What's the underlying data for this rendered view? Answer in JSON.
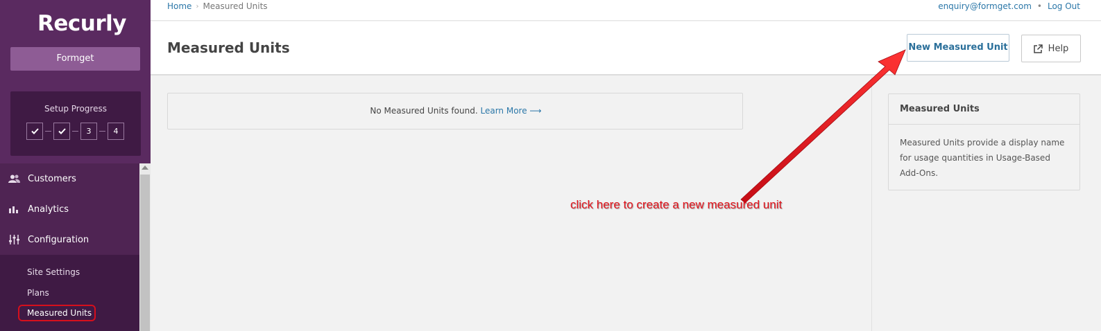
{
  "brand": {
    "logo": "Recurly",
    "site_name": "Formget"
  },
  "setup": {
    "title": "Setup Progress",
    "steps": [
      {
        "label": "",
        "done": true
      },
      {
        "label": "",
        "done": true
      },
      {
        "label": "3",
        "done": false
      },
      {
        "label": "4",
        "done": false
      }
    ]
  },
  "nav": {
    "items": [
      {
        "label": "Customers",
        "icon": "users-icon"
      },
      {
        "label": "Analytics",
        "icon": "bar-chart-icon"
      },
      {
        "label": "Configuration",
        "icon": "sliders-icon"
      }
    ],
    "sub_items": [
      {
        "label": "Site Settings"
      },
      {
        "label": "Plans"
      },
      {
        "label": "Measured Units",
        "active": true
      }
    ]
  },
  "breadcrumb": {
    "home": "Home",
    "current": "Measured Units"
  },
  "user": {
    "email": "enquiry@formget.com",
    "logout": "Log Out"
  },
  "page": {
    "title": "Measured Units",
    "new_button": "New Measured Unit",
    "help_button": "Help",
    "empty_text": "No Measured Units found.",
    "empty_link": "Learn More ⟶"
  },
  "help_panel": {
    "title": "Measured Units",
    "body": "Measured Units provide a display name for usage quantities in Usage-Based Add-Ons."
  },
  "annotation": {
    "text": "click here to create a new measured unit",
    "color": "#e3141c"
  },
  "colors": {
    "sidebar": "#4f2453",
    "accent_link": "#2b77a8"
  }
}
